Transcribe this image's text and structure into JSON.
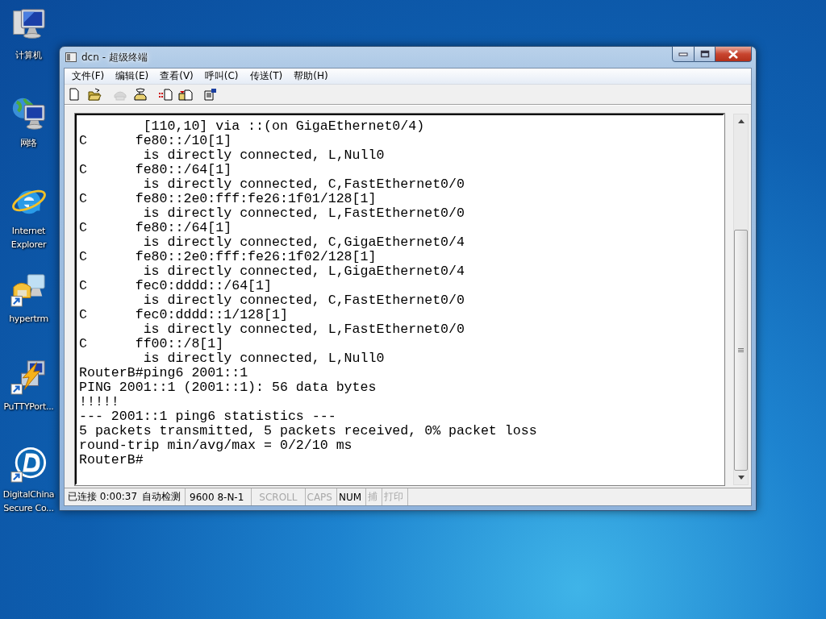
{
  "desktop_icons": [
    {
      "label": "计算机",
      "kind": "computer"
    },
    {
      "label": "网络",
      "kind": "network"
    },
    {
      "label": "Internet Explorer",
      "kind": "browser"
    },
    {
      "label": "hypertrm",
      "kind": "phone"
    },
    {
      "label": "PuTTYPort...",
      "kind": "putty"
    },
    {
      "label": "DigitalChina Secure Co...",
      "kind": "dclogo"
    }
  ],
  "window": {
    "title": "dcn - 超级终端",
    "menu": [
      "文件(F)",
      "编辑(E)",
      "查看(V)",
      "呼叫(C)",
      "传送(T)",
      "帮助(H)"
    ],
    "toolbar": [
      {
        "kind": "new",
        "disabled": false
      },
      {
        "kind": "open",
        "disabled": false
      },
      {
        "kind": "disconnect",
        "disabled": true
      },
      {
        "kind": "call",
        "disabled": false
      },
      {
        "kind": "send",
        "disabled": false
      },
      {
        "kind": "receive",
        "disabled": false
      },
      {
        "kind": "properties",
        "disabled": false
      }
    ],
    "terminal_lines": [
      "        [110,10] via ::(on GigaEthernet0/4)",
      "C      fe80::/10[1]",
      "        is directly connected, L,Null0",
      "C      fe80::/64[1]",
      "        is directly connected, C,FastEthernet0/0",
      "C      fe80::2e0:fff:fe26:1f01/128[1]",
      "        is directly connected, L,FastEthernet0/0",
      "C      fe80::/64[1]",
      "        is directly connected, C,GigaEthernet0/4",
      "C      fe80::2e0:fff:fe26:1f02/128[1]",
      "        is directly connected, L,GigaEthernet0/4",
      "C      fec0:dddd::/64[1]",
      "        is directly connected, C,FastEthernet0/0",
      "C      fec0:dddd::1/128[1]",
      "        is directly connected, L,FastEthernet0/0",
      "C      ff00::/8[1]",
      "        is directly connected, L,Null0",
      "RouterB#ping6 2001::1",
      "PING 2001::1 (2001::1): 56 data bytes",
      "!!!!!",
      "--- 2001::1 ping6 statistics ---",
      "5 packets transmitted, 5 packets received, 0% packet loss",
      "round-trip min/avg/max = 0/2/10 ms",
      "RouterB#"
    ],
    "status_bar": [
      {
        "texts": [
          "已连接 0:00:37",
          "自动检测"
        ],
        "on": true
      },
      {
        "texts": [
          "9600 8-N-1"
        ],
        "on": true
      },
      {
        "texts": [
          "SCROLL"
        ],
        "on": false
      },
      {
        "texts": [
          "CAPS"
        ],
        "on": false
      },
      {
        "texts": [
          "NUM"
        ],
        "on": true
      },
      {
        "texts": [
          "捕"
        ],
        "on": false
      },
      {
        "texts": [
          "打印"
        ],
        "on": false
      }
    ]
  }
}
